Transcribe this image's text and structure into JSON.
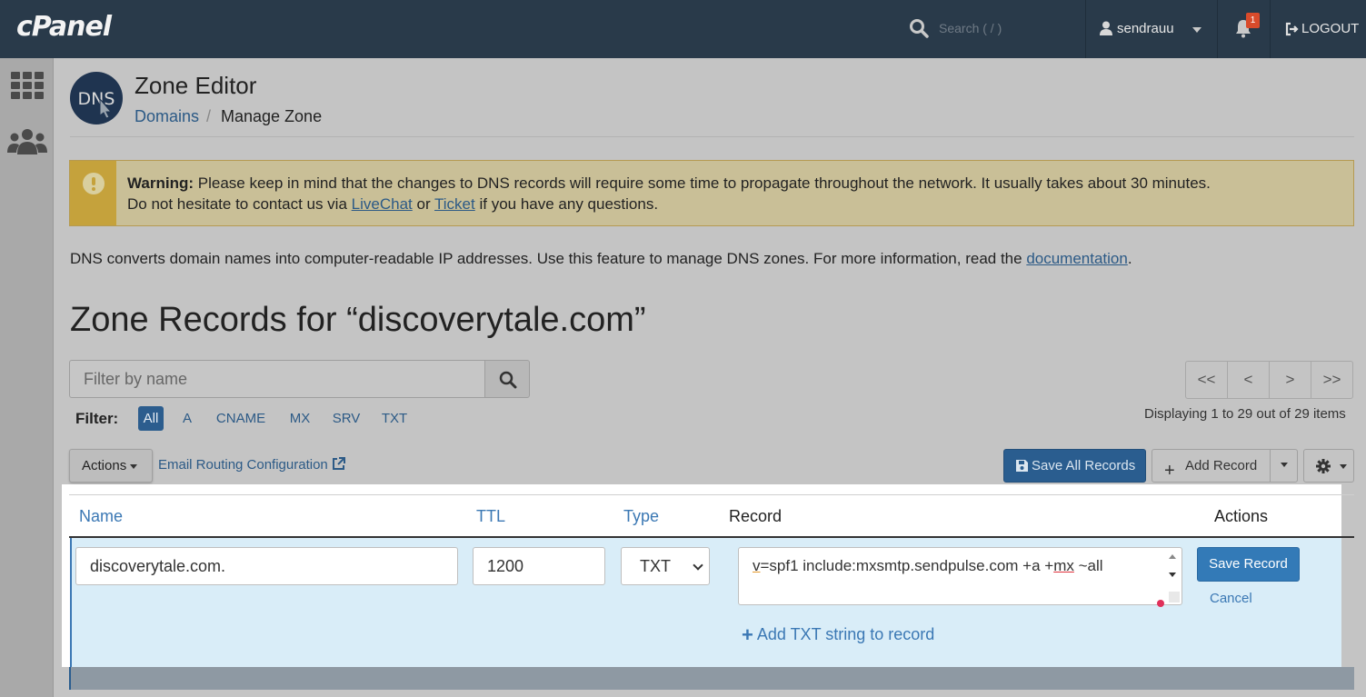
{
  "topbar": {
    "logo": "cPanel",
    "search_placeholder": "Search ( / )",
    "username": "sendrauu",
    "notification_count": "1",
    "logout": "LOGOUT"
  },
  "header": {
    "title": "Zone Editor",
    "breadcrumb_link": "Domains",
    "breadcrumb_sep": "/",
    "breadcrumb_current": "Manage Zone",
    "logo_text": "DNS"
  },
  "warning": {
    "label": "Warning:",
    "line1": " Please keep in mind that the changes to DNS records will require some time to propagate throughout the network. It usually takes about 30 minutes.",
    "line2_a": "Do not hesitate to contact us via ",
    "livechat": "LiveChat",
    "line2_b": " or ",
    "ticket": "Ticket",
    "line2_c": " if you have any questions."
  },
  "description": {
    "text": "DNS converts domain names into computer-readable IP addresses. Use this feature to manage DNS zones. For more information, read the ",
    "link": "documentation",
    "end": "."
  },
  "zone": {
    "title": "Zone Records for “discoverytale.com”"
  },
  "filter": {
    "placeholder": "Filter by name",
    "label": "Filter:",
    "types": [
      "All",
      "A",
      "CNAME",
      "MX",
      "SRV",
      "TXT"
    ],
    "active": "All"
  },
  "pager": {
    "first": "<<",
    "prev": "<",
    "next": ">",
    "last": ">>",
    "display": "Displaying 1 to 29 out of 29 items"
  },
  "toolbar": {
    "actions": "Actions",
    "email_routing": "Email Routing Configuration",
    "save_all": "Save All Records",
    "add_record": "Add Record"
  },
  "table": {
    "col_name": "Name",
    "col_ttl": "TTL",
    "col_type": "Type",
    "col_record": "Record",
    "col_actions": "Actions"
  },
  "edit_row": {
    "name": "discoverytale.com.",
    "ttl": "1200",
    "type": "TXT",
    "record_v": "v",
    "record_mid": "=spf1 include:mxsmtp.sendpulse.com +a +",
    "record_mx": "mx",
    "record_end": " ~all",
    "add_txt": "Add TXT string to record",
    "save_record": "Save Record",
    "cancel": "Cancel"
  },
  "colors": {
    "topbar": "#293a4a",
    "accent": "#337ab7",
    "warning": "#c5a23c"
  }
}
